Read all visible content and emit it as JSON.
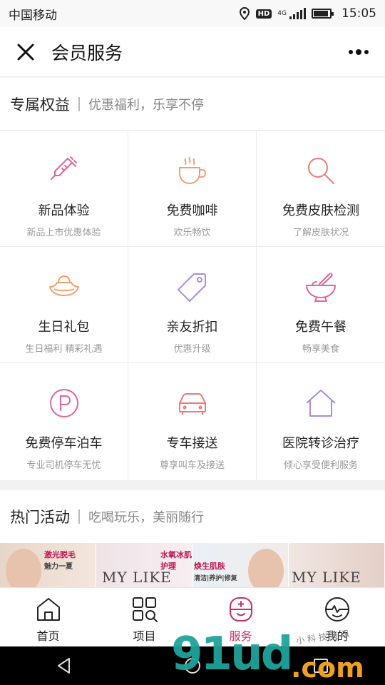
{
  "status_bar": {
    "carrier": "中国移动",
    "hd_badge": "HD",
    "network": "4G",
    "time": "15:05"
  },
  "nav_bar": {
    "title": "会员服务"
  },
  "benefits_section": {
    "title": "专属权益",
    "subtitle": "优惠福利，乐享不停"
  },
  "benefits": [
    {
      "title": "新品体验",
      "subtitle": "新品上市优惠体验",
      "icon": "syringe-icon",
      "color": "#e0659a"
    },
    {
      "title": "免费咖啡",
      "subtitle": "欢乐畅饮",
      "icon": "coffee-cup-icon",
      "color": "#f0a070"
    },
    {
      "title": "免费皮肤检测",
      "subtitle": "了解皮肤状况",
      "icon": "magnifier-icon",
      "color": "#ec7a7a"
    },
    {
      "title": "生日礼包",
      "subtitle": "生日福利 精彩礼遇",
      "icon": "gold-ingot-icon",
      "color": "#f0a070"
    },
    {
      "title": "亲友折扣",
      "subtitle": "优惠升级",
      "icon": "price-tag-icon",
      "color": "#b08ad8"
    },
    {
      "title": "免费午餐",
      "subtitle": "畅享美食",
      "icon": "mortar-bowl-icon",
      "color": "#e0659a"
    },
    {
      "title": "免费停车泊车",
      "subtitle": "专业司机停车无忧",
      "icon": "parking-icon",
      "color": "#e0659a"
    },
    {
      "title": "专车接送",
      "subtitle": "尊享叫车及接送",
      "icon": "car-icon",
      "color": "#ec7a7a"
    },
    {
      "title": "医院转诊治疗",
      "subtitle": "倾心享受便利服务",
      "icon": "house-icon",
      "color": "#b08ad8"
    }
  ],
  "activities_section": {
    "title": "热门活动",
    "subtitle": "吃喝玩乐，美丽随行"
  },
  "banner": {
    "brand": "MY LIKE",
    "promo_1": "激光脱毛",
    "promo_1_sub": "魅力一夏",
    "promo_2": "水氧冰肌护理",
    "promo_3": "焕生肌肤",
    "promo_3_sub": "清洁|养护|修复"
  },
  "tab_bar": [
    {
      "label": "首页",
      "icon": "home-icon",
      "active": false
    },
    {
      "label": "项目",
      "icon": "grid-search-icon",
      "active": false
    },
    {
      "label": "服务",
      "icon": "service-icon",
      "active": true
    },
    {
      "label": "我的",
      "icon": "profile-icon",
      "active": false
    }
  ],
  "watermark": {
    "main": "91ud",
    "suffix": ".com",
    "small": "小 科 技 资 讯"
  },
  "colors": {
    "accent": "#c2306b",
    "pink": "#e0659a",
    "orange": "#f0a070",
    "purple": "#b08ad8"
  }
}
